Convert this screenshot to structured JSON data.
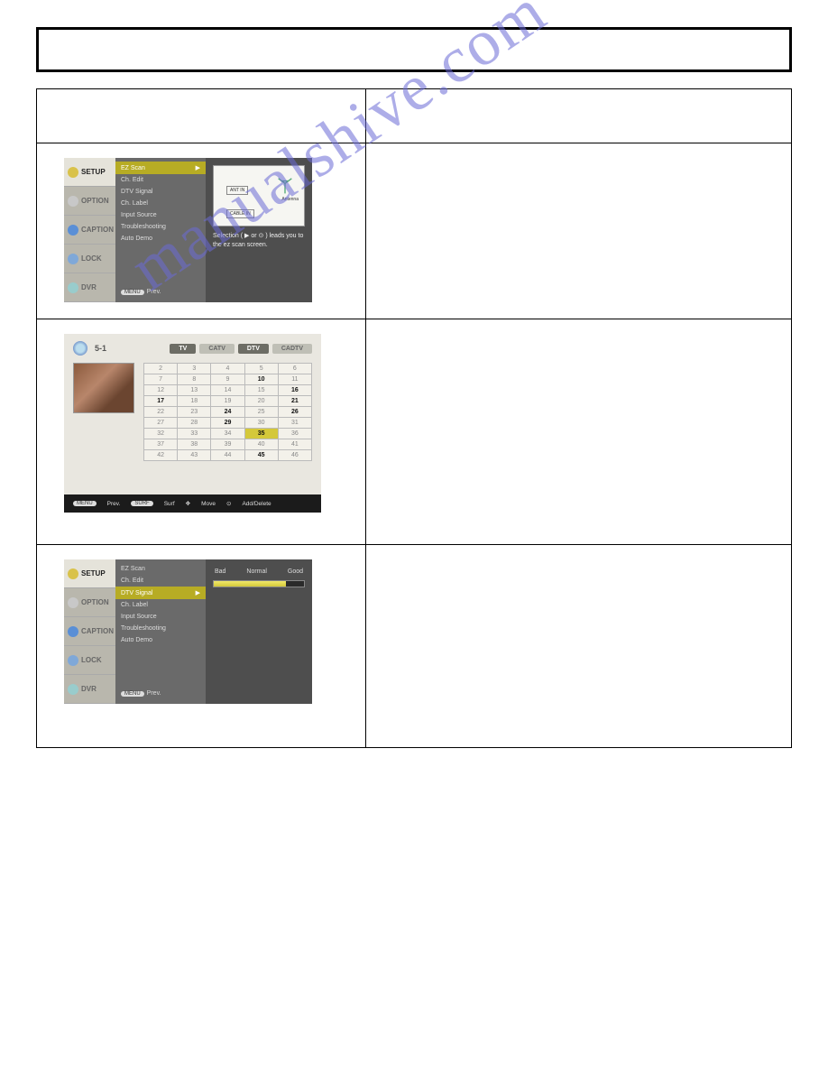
{
  "watermark": "manualshive.com",
  "osd1": {
    "tabs": [
      "SETUP",
      "OPTION",
      "CAPTION",
      "LOCK",
      "DVR"
    ],
    "active_tab": 0,
    "menu": [
      "EZ Scan",
      "Ch. Edit",
      "DTV Signal",
      "Ch. Label",
      "Input Source",
      "Troubleshooting",
      "Auto Demo"
    ],
    "selected": 0,
    "prev_pill": "MENU",
    "prev_text": "Prev.",
    "preview": {
      "ant_in": "ANT IN",
      "cable_in": "CABLE IN",
      "antenna_label": "Antenna"
    },
    "hint": "Selection ( ▶ or ⊙ ) leads you to the ez scan screen."
  },
  "osd2": {
    "channel_no": "5-1",
    "tabs": [
      {
        "label": "TV",
        "on": true
      },
      {
        "label": "CATV",
        "on": false
      },
      {
        "label": "DTV",
        "on": true
      },
      {
        "label": "CADTV",
        "on": false
      }
    ],
    "grid": [
      [
        {
          "v": "2"
        },
        {
          "v": "3"
        },
        {
          "v": "4"
        },
        {
          "v": "5"
        },
        {
          "v": "6"
        }
      ],
      [
        {
          "v": "7"
        },
        {
          "v": "8"
        },
        {
          "v": "9"
        },
        {
          "v": "10",
          "b": true
        },
        {
          "v": "11"
        }
      ],
      [
        {
          "v": "12"
        },
        {
          "v": "13"
        },
        {
          "v": "14"
        },
        {
          "v": "15"
        },
        {
          "v": "16",
          "b": true
        }
      ],
      [
        {
          "v": "17",
          "b": true
        },
        {
          "v": "18"
        },
        {
          "v": "19"
        },
        {
          "v": "20"
        },
        {
          "v": "21",
          "b": true
        }
      ],
      [
        {
          "v": "22"
        },
        {
          "v": "23"
        },
        {
          "v": "24",
          "b": true
        },
        {
          "v": "25"
        },
        {
          "v": "26",
          "b": true
        }
      ],
      [
        {
          "v": "27"
        },
        {
          "v": "28"
        },
        {
          "v": "29",
          "b": true
        },
        {
          "v": "30"
        },
        {
          "v": "31"
        }
      ],
      [
        {
          "v": "32"
        },
        {
          "v": "33"
        },
        {
          "v": "34"
        },
        {
          "v": "35",
          "hl": true
        },
        {
          "v": "36"
        }
      ],
      [
        {
          "v": "37"
        },
        {
          "v": "38"
        },
        {
          "v": "39"
        },
        {
          "v": "40"
        },
        {
          "v": "41"
        }
      ],
      [
        {
          "v": "42"
        },
        {
          "v": "43"
        },
        {
          "v": "44"
        },
        {
          "v": "45",
          "b": true
        },
        {
          "v": "46"
        }
      ]
    ],
    "bottom": {
      "prev_pill": "MENU",
      "prev": "Prev.",
      "surf_pill": "SURF",
      "surf": "Surf",
      "move_icon": "✥",
      "move": "Move",
      "add_icon": "⊙",
      "add": "Add/Delete"
    }
  },
  "osd3": {
    "tabs": [
      "SETUP",
      "OPTION",
      "CAPTION",
      "LOCK",
      "DVR"
    ],
    "active_tab": 0,
    "menu": [
      "EZ Scan",
      "Ch. Edit",
      "DTV Signal",
      "Ch. Label",
      "Input Source",
      "Troubleshooting",
      "Auto Demo"
    ],
    "selected": 2,
    "prev_pill": "MENU",
    "prev_text": "Prev.",
    "sig": {
      "bad": "Bad",
      "normal": "Normal",
      "good": "Good"
    }
  }
}
